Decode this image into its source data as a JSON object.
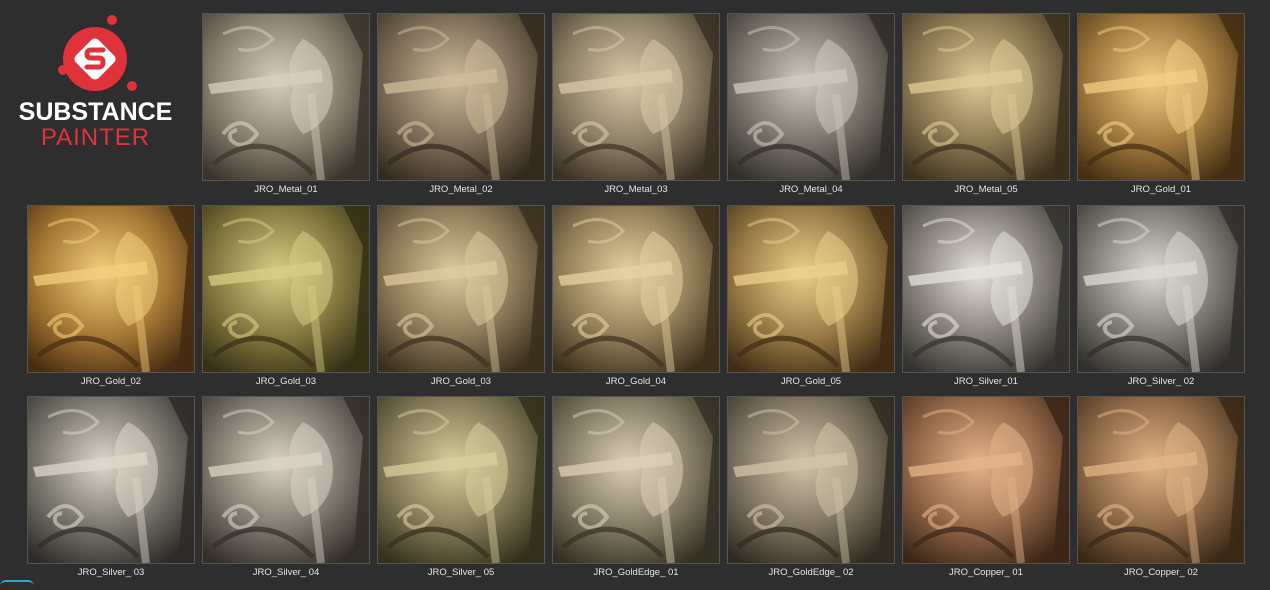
{
  "logo": {
    "line1": "SUBSTANCE",
    "line2": "PAINTER",
    "brand_color": "#e0323a"
  },
  "materials": [
    {
      "label": "JRO_Metal_01",
      "base": "#8a8070",
      "hi": "#d8d0bf",
      "shade": "#3a342c"
    },
    {
      "label": "JRO_Metal_02",
      "base": "#7c6e58",
      "hi": "#cdbd9a",
      "shade": "#332a1f"
    },
    {
      "label": "JRO_Metal_03",
      "base": "#8c8066",
      "hi": "#d9cba8",
      "shade": "#3a3024"
    },
    {
      "label": "JRO_Metal_04",
      "base": "#77736a",
      "hi": "#cfcac0",
      "shade": "#302d28"
    },
    {
      "label": "JRO_Metal_05",
      "base": "#8a7852",
      "hi": "#e0cc98",
      "shade": "#3a301c"
    },
    {
      "label": "JRO_Gold_01",
      "base": "#a07a3e",
      "hi": "#f0cf86",
      "shade": "#442e12"
    },
    {
      "label": "JRO_Gold_02",
      "base": "#a87a36",
      "hi": "#f4cf7c",
      "shade": "#462c10"
    },
    {
      "label": "JRO_Gold_03",
      "base": "#857a40",
      "hi": "#d6cf86",
      "shade": "#343014"
    },
    {
      "label": "JRO_Gold_03",
      "base": "#8c7a58",
      "hi": "#dccaa0",
      "shade": "#3a301e"
    },
    {
      "label": "JRO_Gold_04",
      "base": "#93805a",
      "hi": "#e6d2a2",
      "shade": "#3c301c"
    },
    {
      "label": "JRO_Gold_05",
      "base": "#9a7c46",
      "hi": "#ecd08c",
      "shade": "#402c14"
    },
    {
      "label": "JRO_Silver_01",
      "base": "#85817a",
      "hi": "#e6e3dc",
      "shade": "#34322e"
    },
    {
      "label": "JRO_Silver_ 02",
      "base": "#7f7c76",
      "hi": "#dedbd4",
      "shade": "#302e2a"
    },
    {
      "label": "JRO_Silver_ 03",
      "base": "#7a776e",
      "hi": "#dcd8cc",
      "shade": "#2e2c28"
    },
    {
      "label": "JRO_Silver_ 04",
      "base": "#807a70",
      "hi": "#dbd4c6",
      "shade": "#322e28"
    },
    {
      "label": "JRO_Silver_ 05",
      "base": "#847c58",
      "hi": "#d8cf9e",
      "shade": "#33301c"
    },
    {
      "label": "JRO_GoldEdge_ 01",
      "base": "#857c66",
      "hi": "#dcd2b8",
      "shade": "#343024"
    },
    {
      "label": "JRO_GoldEdge_ 02",
      "base": "#7e7462",
      "hi": "#d2c6a8",
      "shade": "#302a20"
    },
    {
      "label": "JRO_Copper_ 01",
      "base": "#94694a",
      "hi": "#e6b48a",
      "shade": "#3c2616"
    },
    {
      "label": "JRO_Copper_ 02",
      "base": "#8e6a48",
      "hi": "#e2b688",
      "shade": "#3a2816"
    }
  ]
}
